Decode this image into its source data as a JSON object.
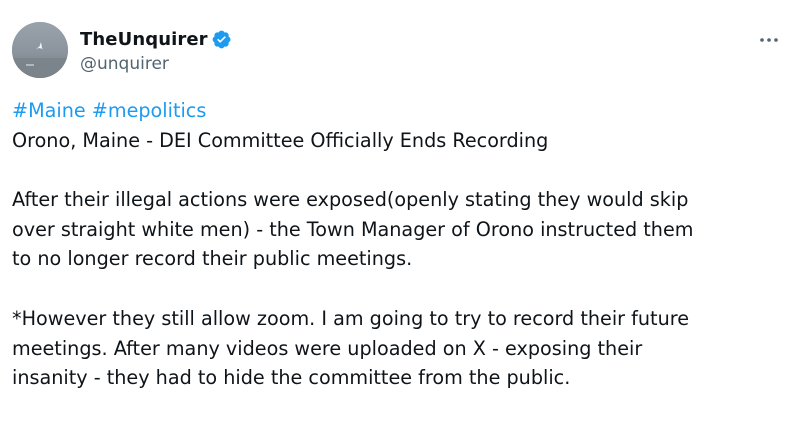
{
  "author": {
    "display_name": "TheUnquirer",
    "handle": "@unquirer",
    "verified_icon": "verified-badge-icon",
    "avatar_icon": "avatar-photo"
  },
  "menu": {
    "more_icon": "more-options-icon"
  },
  "tweet": {
    "hashtags": [
      "#Maine",
      "#mepolitics"
    ],
    "lines": [
      "Orono, Maine - DEI Committee Officially Ends Recording",
      "After their illegal actions were exposed(openly stating they would skip",
      "over straight white men) - the Town Manager of Orono instructed them",
      "to no longer record their public meetings.",
      "*However they still allow zoom.  I am going to try to record their future",
      "meetings.  After many videos were uploaded on X - exposing their",
      "insanity - they had to hide the committee from the public."
    ]
  },
  "colors": {
    "link": "#1d9bf0",
    "text": "#0f1419",
    "secondary": "#536471"
  }
}
